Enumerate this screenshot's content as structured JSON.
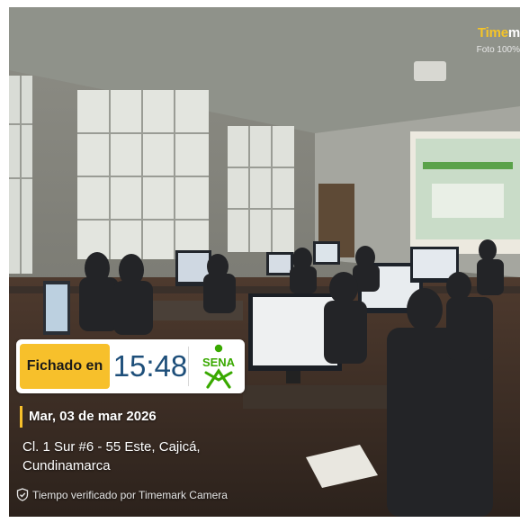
{
  "watermark": {
    "brand_highlight": "Time",
    "brand_rest": "m",
    "subtitle": "Foto 100%"
  },
  "stamp": {
    "label": "Fichado en",
    "time": "15:48",
    "logo_text": "SENA",
    "logo_color": "#39a900",
    "accent_color": "#f7c02b"
  },
  "details": {
    "date": "Mar, 03 de mar 2026",
    "address": "Cl. 1 Sur #6 - 55 Este, Cajicá, Cundinamarca",
    "verified_text": "Tiempo verificado por Timemark Camera",
    "verified_icon": "shield-check-icon"
  }
}
